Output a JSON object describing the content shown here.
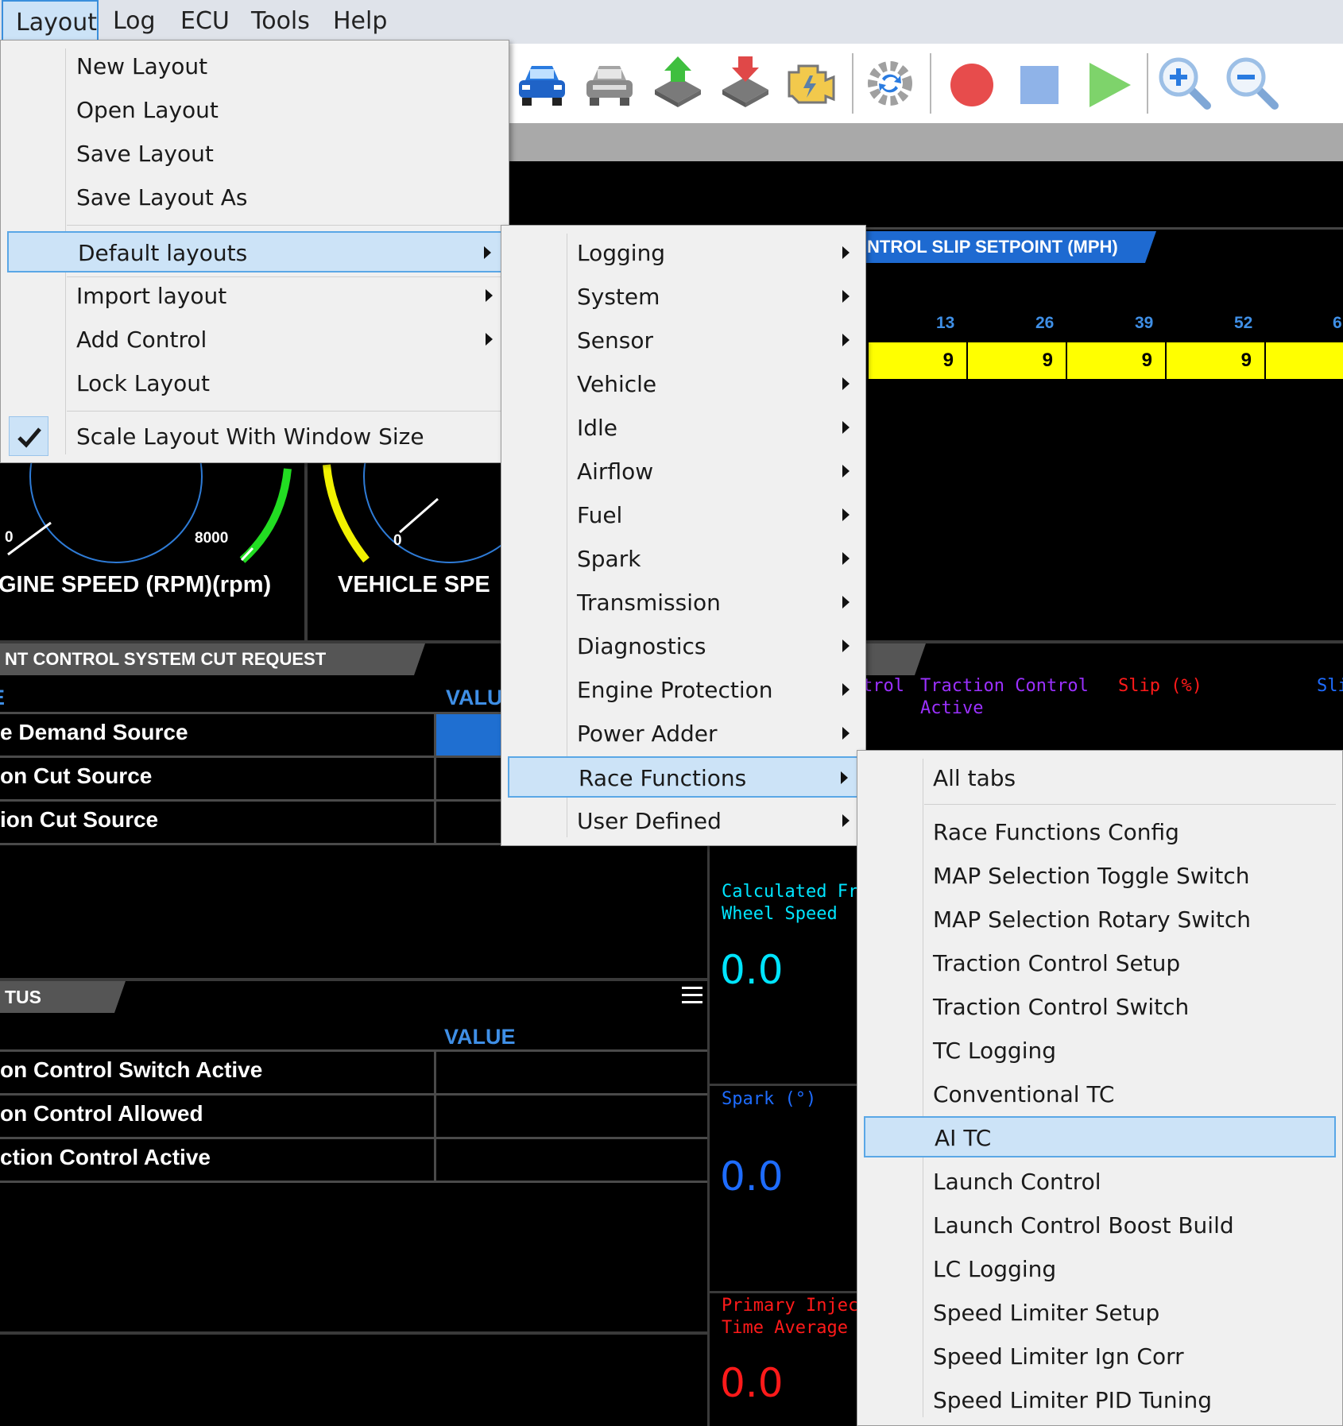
{
  "menubar": {
    "items": [
      "Layout",
      "Log",
      "ECU",
      "Tools",
      "Help"
    ]
  },
  "toolbar": {
    "icons": [
      "car-blue-icon",
      "car-grey-icon",
      "upload-chip-icon",
      "download-chip-icon",
      "engine-icon",
      "sync-icon",
      "record-icon",
      "stop-icon",
      "play-icon",
      "zoom-in-icon",
      "zoom-out-icon"
    ]
  },
  "layout_menu": {
    "items": [
      "New Layout",
      "Open Layout",
      "Save Layout",
      "Save Layout As",
      "Default layouts",
      "Import layout",
      "Add Control",
      "Lock Layout",
      "Scale Layout With Window Size"
    ],
    "checked_item": "Scale Layout With Window Size",
    "highlighted_item": "Default layouts"
  },
  "default_layouts_menu": {
    "items": [
      "Logging",
      "System",
      "Sensor",
      "Vehicle",
      "Idle",
      "Airflow",
      "Fuel",
      "Spark",
      "Transmission",
      "Diagnostics",
      "Engine Protection",
      "Power Adder",
      "Race Functions",
      "User Defined"
    ],
    "highlighted_item": "Race Functions"
  },
  "race_functions_menu": {
    "items": [
      "All tabs",
      "Race Functions Config",
      "MAP Selection Toggle Switch",
      "MAP Selection Rotary Switch",
      "Traction Control Setup",
      "Traction Control Switch",
      "TC Logging",
      "Conventional TC",
      "AI TC",
      "Launch Control",
      "Launch Control Boost Build",
      "LC Logging",
      "Speed Limiter Setup",
      "Speed Limiter Ign Corr",
      "Speed Limiter PID Tuning"
    ],
    "highlighted_item": "AI TC"
  },
  "dashboard": {
    "slip_panel": {
      "title": "NTROL SLIP SETPOINT (MPH)",
      "columns": [
        "13",
        "26",
        "39",
        "52",
        "6"
      ],
      "values": [
        "9",
        "9",
        "9",
        "9",
        ""
      ]
    },
    "gauges": {
      "engine_speed": {
        "label": "GINE SPEED (RPM)(rpm)",
        "min": "0",
        "max": "8000"
      },
      "vehicle_speed": {
        "label": "VEHICLE SPE",
        "min": "0"
      }
    },
    "cut_panel": {
      "title": "NT CONTROL SYSTEM CUT REQUEST",
      "header_left": "E",
      "header_value": "VALU",
      "rows": [
        "e Demand Source",
        "on Cut Source",
        "ion Cut Source"
      ]
    },
    "status_panel": {
      "title": "TUS",
      "header_value": "VALUE",
      "rows": [
        "on Control Switch Active",
        "on Control Allowed",
        "ction Control Active"
      ]
    },
    "tc_graph_labels": {
      "trol": "trol",
      "tc_active": "Traction Control\nActive",
      "slip": "Slip (%)",
      "slip2": "Sli"
    },
    "readouts": [
      {
        "label": "Calculated Fro\nWheel Speed",
        "value": "0.0",
        "color": "#00e5ff"
      },
      {
        "label": "Spark (°)",
        "value": "0.0",
        "color": "#1e6cff"
      },
      {
        "label": "Primary Injectio\nTime Average",
        "value": "0.0",
        "color": "#ff1a1a"
      }
    ]
  },
  "colors": {
    "menu_highlight": "#cce3f7",
    "menu_highlight_border": "#5aa7e6",
    "accent_blue": "#3f8fe6",
    "slip_cell": "#ffff00"
  }
}
